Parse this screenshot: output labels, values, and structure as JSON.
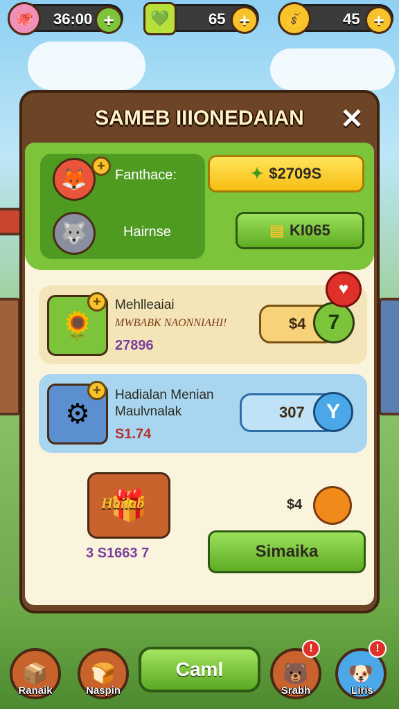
{
  "resources": [
    {
      "icon": "creature-icon",
      "glyph": "🐙",
      "value": "36:00",
      "plus_glyph": "+",
      "icon_color": "#f08fb8",
      "plus_color": "#7cc43a"
    },
    {
      "icon": "gem-box-icon",
      "glyph": "💚",
      "value": "65",
      "plus_glyph": "+",
      "icon_color": "#b8e03a",
      "plus_color": "#f7c22a"
    },
    {
      "icon": "coin-pouch-icon",
      "glyph": "💰",
      "value": "45",
      "plus_glyph": "+",
      "icon_color": "#f7c22a",
      "plus_color": "#f7c22a"
    }
  ],
  "dialog": {
    "title": "SAMEB IIIONEDAIAN",
    "close_glyph": "✕",
    "featured": {
      "items": [
        {
          "label": "Fanthace:",
          "char_glyph": "🦊",
          "char_icon": "fire-creature-icon"
        },
        {
          "label": "Hairnse",
          "char_glyph": "🐺",
          "char_icon": "wolf-character-icon"
        }
      ],
      "buy_gem": {
        "label": "$2709S",
        "glyph": "✦"
      },
      "buy_gold": {
        "label": "KI065",
        "glyph": "▤"
      }
    },
    "offers": [
      {
        "title": "Mehlleaiai",
        "subtitle": "MWBABK NAONNIAHI!",
        "stat": "27896",
        "price": "$4",
        "level": "7",
        "thumb_glyph": "🌻",
        "tag_glyph": "♥"
      },
      {
        "title": "Hadialan Menian",
        "subtitle": "Maulvnalak",
        "stat": "S1.74",
        "price": "307",
        "level": "Y",
        "thumb_glyph": "⚙"
      }
    ],
    "bundle": {
      "title": "Hailab",
      "stat": "3 S1663 7",
      "price": "$4",
      "button_label": "Simaika",
      "chest_glyph": "🎁"
    }
  },
  "bottom_nav": {
    "items": [
      {
        "label": "Ranaik",
        "glyph": "📦",
        "badge": ""
      },
      {
        "label": "Naspin",
        "glyph": "🍞",
        "badge": ""
      },
      {
        "label": "Srabh",
        "glyph": "🐻",
        "badge": "!"
      },
      {
        "label": "Liris",
        "glyph": "🐶",
        "badge": "!"
      }
    ],
    "center_label": "Caml"
  },
  "colors": {
    "accent_green": "#7cc43a",
    "wood": "#6e4426",
    "cream": "#fbf4dc",
    "gold": "#f7c22a"
  }
}
